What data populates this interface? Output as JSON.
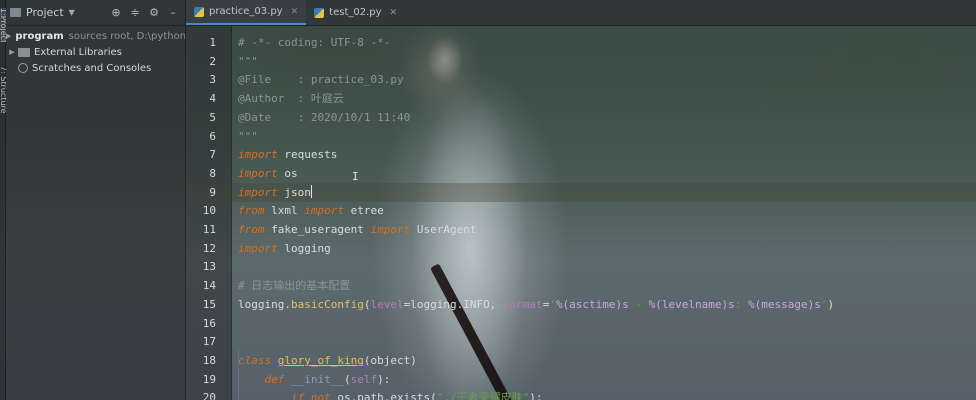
{
  "tool_strip": {
    "tab1": "1:Project",
    "tab2": "7: Structure"
  },
  "project_panel": {
    "title": "Project",
    "tree": [
      {
        "name": "program",
        "hint": "sources root, D:\\python\\py",
        "bold": true
      },
      {
        "name": "External Libraries",
        "hint": "",
        "bold": false
      },
      {
        "name": "Scratches and Consoles",
        "hint": "",
        "bold": false
      }
    ]
  },
  "tabs": [
    {
      "label": "practice_03.py",
      "active": true
    },
    {
      "label": "test_02.py",
      "active": false
    }
  ],
  "editor": {
    "current_line": 9,
    "lines": [
      {
        "n": "1",
        "segs": [
          {
            "t": "# -*- coding: UTF-8 -*-",
            "c": "c-comment"
          }
        ]
      },
      {
        "n": "2",
        "segs": [
          {
            "t": "\"\"\"",
            "c": "c-doc"
          }
        ]
      },
      {
        "n": "3",
        "segs": [
          {
            "t": "@File    : practice_03.py",
            "c": "c-doc"
          }
        ]
      },
      {
        "n": "4",
        "segs": [
          {
            "t": "@Author  : 叶庭云",
            "c": "c-doc"
          }
        ]
      },
      {
        "n": "5",
        "segs": [
          {
            "t": "@Date    : 2020/10/1 11:40",
            "c": "c-doc"
          }
        ]
      },
      {
        "n": "6",
        "segs": [
          {
            "t": "\"\"\"",
            "c": "c-doc"
          }
        ]
      },
      {
        "n": "7",
        "segs": [
          {
            "t": "import",
            "c": "c-kw"
          },
          {
            "t": " requests",
            "c": ""
          }
        ]
      },
      {
        "n": "8",
        "segs": [
          {
            "t": "import",
            "c": "c-kw"
          },
          {
            "t": " os",
            "c": ""
          }
        ]
      },
      {
        "n": "9",
        "segs": [
          {
            "t": "import",
            "c": "c-kw"
          },
          {
            "t": " json",
            "c": ""
          }
        ]
      },
      {
        "n": "10",
        "segs": [
          {
            "t": "from",
            "c": "c-kw"
          },
          {
            "t": " lxml ",
            "c": ""
          },
          {
            "t": "import",
            "c": "c-kw"
          },
          {
            "t": " etree",
            "c": ""
          }
        ]
      },
      {
        "n": "11",
        "segs": [
          {
            "t": "from",
            "c": "c-kw"
          },
          {
            "t": " fake_useragent ",
            "c": ""
          },
          {
            "t": "import",
            "c": "c-kw"
          },
          {
            "t": " UserAgent",
            "c": ""
          }
        ]
      },
      {
        "n": "12",
        "segs": [
          {
            "t": "import",
            "c": "c-kw"
          },
          {
            "t": " logging",
            "c": ""
          }
        ]
      },
      {
        "n": "13",
        "segs": []
      },
      {
        "n": "14",
        "segs": [
          {
            "t": "# 日志输出的基本配置",
            "c": "c-comment"
          }
        ]
      },
      {
        "n": "15",
        "segs": [
          {
            "t": "logging.",
            "c": ""
          },
          {
            "t": "basicConfig",
            "c": "c-func"
          },
          {
            "t": "(",
            "c": ""
          },
          {
            "t": "level",
            "c": "c-param"
          },
          {
            "t": "=logging.INFO, ",
            "c": ""
          },
          {
            "t": "format",
            "c": "c-param"
          },
          {
            "t": "=",
            "c": ""
          },
          {
            "t": "'",
            "c": "c-str"
          },
          {
            "t": "%(asctime)s",
            "c": "c-fmt"
          },
          {
            "t": " - ",
            "c": "c-str"
          },
          {
            "t": "%(levelname)s",
            "c": "c-fmt"
          },
          {
            "t": ": ",
            "c": "c-str"
          },
          {
            "t": "%(message)s",
            "c": "c-fmt"
          },
          {
            "t": "'",
            "c": "c-str"
          },
          {
            "t": ")",
            "c": ""
          }
        ]
      },
      {
        "n": "16",
        "segs": []
      },
      {
        "n": "17",
        "segs": []
      },
      {
        "n": "18",
        "segs": [
          {
            "t": "class",
            "c": "c-kw"
          },
          {
            "t": " ",
            "c": ""
          },
          {
            "t": "glory_of_king",
            "c": "c-def"
          },
          {
            "t": "(object)",
            "c": ""
          }
        ]
      },
      {
        "n": "19",
        "segs": [
          {
            "t": "    ",
            "c": ""
          },
          {
            "t": "def",
            "c": "c-kw"
          },
          {
            "t": " ",
            "c": ""
          },
          {
            "t": "__init__",
            "c": "c-builtin"
          },
          {
            "t": "(",
            "c": ""
          },
          {
            "t": "self",
            "c": "c-self"
          },
          {
            "t": "):",
            "c": ""
          }
        ]
      },
      {
        "n": "20",
        "segs": [
          {
            "t": "        ",
            "c": ""
          },
          {
            "t": "if not",
            "c": "c-kw"
          },
          {
            "t": " os.path.exists(",
            "c": ""
          },
          {
            "t": "\"./王者荣耀皮肤\"",
            "c": "c-str"
          },
          {
            "t": "):",
            "c": ""
          }
        ]
      }
    ]
  },
  "icons": {
    "panel_header": [
      "target-icon",
      "collapse-icon",
      "gear-icon",
      "hide-icon"
    ]
  }
}
